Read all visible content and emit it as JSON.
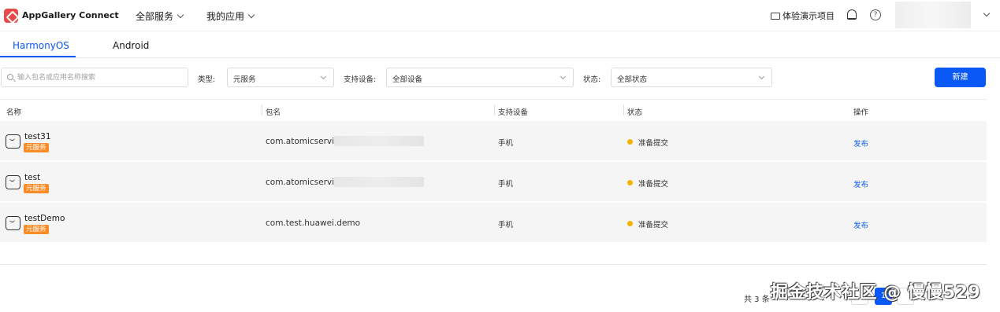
{
  "topbar": {
    "brand": "AppGallery Connect",
    "nav": [
      {
        "label": "全部服务"
      },
      {
        "label": "我的应用"
      }
    ],
    "demo_label": "体验演示项目"
  },
  "tabs": [
    {
      "label": "HarmonyOS",
      "active": true
    },
    {
      "label": "Android",
      "active": false
    }
  ],
  "filters": {
    "search_placeholder": "输入包名或应用名称搜索",
    "type_label": "类型:",
    "type_value": "元服务",
    "device_label": "支持设备:",
    "device_value": "全部设备",
    "status_label": "状态:",
    "status_value": "全部状态",
    "new_button": "新建"
  },
  "table": {
    "headers": [
      "名称",
      "包名",
      "支持设备",
      "状态",
      "操作"
    ],
    "rows": [
      {
        "name": "test31",
        "badge": "元服务",
        "package": "com.atomicservice.",
        "device": "手机",
        "status": "准备提交",
        "action": "发布"
      },
      {
        "name": "test",
        "badge": "元服务",
        "package": "com.atomicservice.",
        "device": "手机",
        "status": "准备提交",
        "action": "发布"
      },
      {
        "name": "testDemo",
        "badge": "元服务",
        "package": "com.test.huawei.demo",
        "device": "手机",
        "status": "准备提交",
        "action": "发布"
      }
    ]
  },
  "pagination": {
    "total": "共 3 条",
    "current_page": "1"
  },
  "watermark": "掘金技术社区 @ 慢慢529",
  "colors": {
    "accent": "#0a59f7",
    "badge": "#fa8c28",
    "status_dot": "#f5b400",
    "row_bg": "#f5f5f5"
  },
  "icons": [
    "app-logo-icon",
    "chevron-down-icon",
    "demo-icon",
    "bell-icon",
    "help-icon",
    "search-icon",
    "app-icon"
  ]
}
